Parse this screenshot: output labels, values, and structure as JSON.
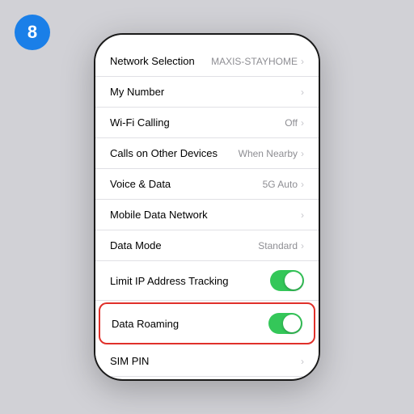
{
  "badge": {
    "number": "8"
  },
  "settings": {
    "rows": [
      {
        "label": "Network Selection",
        "value": "MAXIS-STAYHOME",
        "type": "chevron",
        "toggle_state": null
      },
      {
        "label": "My Number",
        "value": "",
        "type": "chevron",
        "toggle_state": null
      },
      {
        "label": "Wi-Fi Calling",
        "value": "Off",
        "type": "chevron",
        "toggle_state": null
      },
      {
        "label": "Calls on Other Devices",
        "value": "When Nearby",
        "type": "chevron",
        "toggle_state": null
      },
      {
        "label": "Voice & Data",
        "value": "5G Auto",
        "type": "chevron",
        "toggle_state": null
      },
      {
        "label": "Mobile Data Network",
        "value": "",
        "type": "chevron",
        "toggle_state": null
      },
      {
        "label": "Data Mode",
        "value": "Standard",
        "type": "chevron",
        "toggle_state": null
      },
      {
        "label": "Limit IP Address Tracking",
        "value": "",
        "type": "toggle",
        "toggle_state": "on"
      },
      {
        "label": "Data Roaming",
        "value": "",
        "type": "toggle",
        "toggle_state": "on",
        "highlighted": true
      },
      {
        "label": "SIM PIN",
        "value": "",
        "type": "chevron",
        "toggle_state": null
      }
    ]
  }
}
